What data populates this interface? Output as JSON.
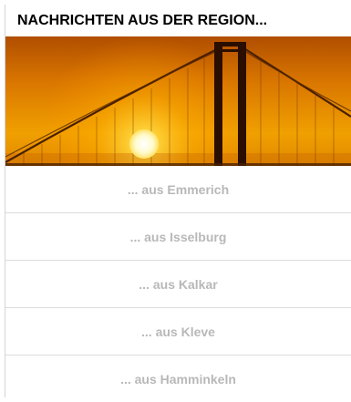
{
  "widget": {
    "title": "NACHRICHTEN AUS DER REGION...",
    "hero_image": "sunset-bridge-photo"
  },
  "regions": [
    {
      "label": "... aus Emmerich"
    },
    {
      "label": "... aus Isselburg"
    },
    {
      "label": "... aus Kalkar"
    },
    {
      "label": "... aus Kleve"
    },
    {
      "label": "... aus Hamminkeln"
    }
  ],
  "colors": {
    "title_text": "#000000",
    "link_text": "#b8b8b8",
    "divider": "#dcdcdc",
    "sky_top": "#c85a00",
    "sky_glow": "#ffb400"
  }
}
